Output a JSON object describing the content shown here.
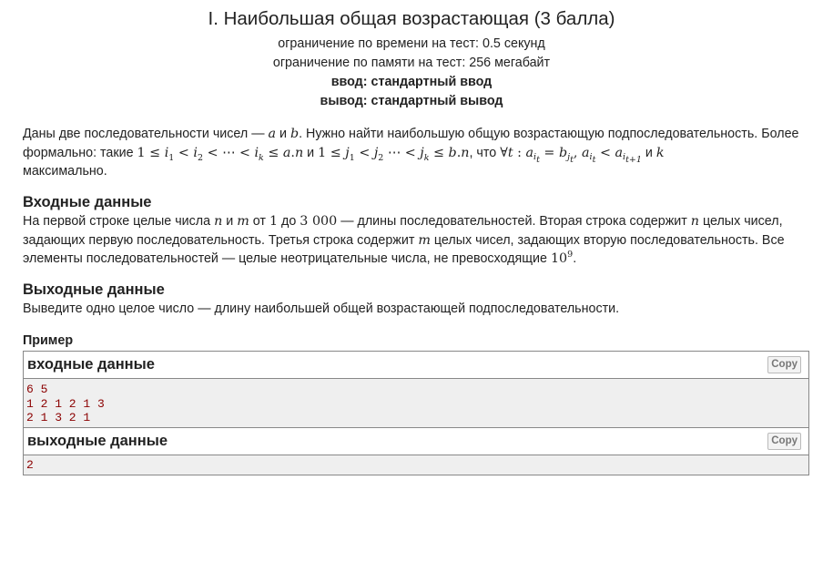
{
  "header": {
    "title": "I. Наибольшая общая возрастающая (3 балла)",
    "time_limit": "ограничение по времени на тест: 0.5 секунд",
    "memory_limit": "ограничение по памяти на тест: 256 мегабайт",
    "input": "ввод: стандартный ввод",
    "output": "вывод: стандартный вывод"
  },
  "legend": {
    "t1": "Даны две последовательности чисел — ",
    "a": "a",
    "and": " и ",
    "b": "b",
    "t2": ". Нужно найти наибольшую общую возрастающую подпоследовательность. Более формально: такие ",
    "t3": "максимально."
  },
  "input_spec": {
    "title": "Входные данные",
    "t1": "На первой строке целые числа ",
    "n": "n",
    "and": " и ",
    "m": "m",
    "from": " от ",
    "one": "1",
    "to": " до ",
    "max": "3 000",
    "t2": " — длины последовательностей. Вторая строка содержит ",
    "t3": " целых чисел, задающих первую последовательность. Третья строка содержит ",
    "t4": " целых чисел, задающих вторую последовательность. Все элементы последовательностей — целые неотрицательные числа, не превосходящие ",
    "ten": "10",
    "nine": "9",
    "end": "."
  },
  "output_spec": {
    "title": "Выходные данные",
    "text": "Выведите одно целое число — длину наибольшей общей возрастающей подпоследовательности."
  },
  "sample": {
    "title": "Пример",
    "input_label": "входные данные",
    "output_label": "выходные данные",
    "copy_label": "Copy",
    "input_text": "6 5\n1 2 1 2 1 3\n2 1 3 2 1",
    "output_text": "2"
  }
}
